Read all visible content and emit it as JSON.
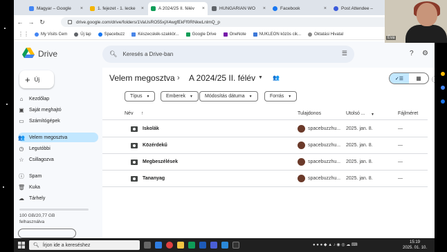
{
  "browser": {
    "tabs": [
      {
        "label": "Magyar – Google",
        "color": "#4285f4"
      },
      {
        "label": "1. fejezet - 1. lecke",
        "color": "#f4b400"
      },
      {
        "label": "A 2024/25 II. félév",
        "color": "#0f9d58",
        "active": true
      },
      {
        "label": "HUNGARIAN WO",
        "color": "#5f6368"
      },
      {
        "label": "Facebook",
        "color": "#1877f2"
      },
      {
        "label": "Post Attendee –",
        "color": "#3b5bdb"
      }
    ],
    "url": "drive.google.com/drive/folders/1VaUsRO55xjX4wgfEkFf0RNkwLnlmQ_p",
    "bookmarks": [
      {
        "label": "My Visits Cem",
        "color": "#4285f4"
      },
      {
        "label": "Új lap",
        "color": "#5f6368"
      },
      {
        "label": "Spacebuzz",
        "color": "#1877f2"
      },
      {
        "label": "Készecskék-szakkör...",
        "color": "#4a86e8"
      },
      {
        "label": "Google Drive",
        "color": "#0f9d58"
      },
      {
        "label": "OneNote",
        "color": "#7719aa"
      },
      {
        "label": "NUKLEON közös cik...",
        "color": "#3c78d8"
      },
      {
        "label": "Oktatási Hivatal",
        "color": "#888888"
      }
    ]
  },
  "webcam": {
    "label": "Éva"
  },
  "drive": {
    "app_name": "Drive",
    "search_placeholder": "Keresés a Drive-ban",
    "new_button": "Új",
    "nav": [
      {
        "label": "Kezdőlap",
        "icon": "home-icon",
        "glyph": "⌂"
      },
      {
        "label": "Saját meghajtó",
        "icon": "drive-icon",
        "glyph": "▣"
      },
      {
        "label": "Számítógépek",
        "icon": "computer-icon",
        "glyph": "▭"
      },
      {
        "label": "Velem megosztva",
        "icon": "shared-icon",
        "glyph": "👥",
        "active": true
      },
      {
        "label": "Legutóbbi",
        "icon": "clock-icon",
        "glyph": "◷"
      },
      {
        "label": "Csillagozva",
        "icon": "star-icon",
        "glyph": "☆"
      },
      {
        "label": "Spam",
        "icon": "spam-icon",
        "glyph": "ⓘ"
      },
      {
        "label": "Kuka",
        "icon": "trash-icon",
        "glyph": "🗑"
      },
      {
        "label": "Tárhely",
        "icon": "cloud-icon",
        "glyph": "☁"
      }
    ],
    "storage_line1": "100 GB/20,77 GB",
    "storage_line2": "felhasználva",
    "breadcrumb_root": "Velem megosztva",
    "breadcrumb_sep": "›",
    "breadcrumb_current": "A 2024/25 II. félév",
    "filters": [
      {
        "label": "Típus"
      },
      {
        "label": "Emberek"
      },
      {
        "label": "Módosítás dátuma"
      },
      {
        "label": "Forrás"
      }
    ],
    "columns": {
      "name": "Név",
      "owner": "Tulajdonos",
      "date": "Utolsó ...",
      "size": "Fájlméret"
    },
    "rows": [
      {
        "name": "Iskolák",
        "owner": "spacebuzzhu...",
        "date": "2025. jan. 8.",
        "size": "—"
      },
      {
        "name": "Közérdekű",
        "owner": "spacebuzzhu...",
        "date": "2025. jan. 8.",
        "size": "—"
      },
      {
        "name": "Megbeszélések",
        "owner": "spacebuzzhu...",
        "date": "2025. jan. 8.",
        "size": "—"
      },
      {
        "name": "Tananyag",
        "owner": "spacebuzzhu...",
        "date": "2025. jan. 8.",
        "size": "—"
      }
    ]
  },
  "taskbar": {
    "search_placeholder": "Írjon ide a kereséshez",
    "time": "15:19",
    "date": "2025. 01. 10."
  }
}
